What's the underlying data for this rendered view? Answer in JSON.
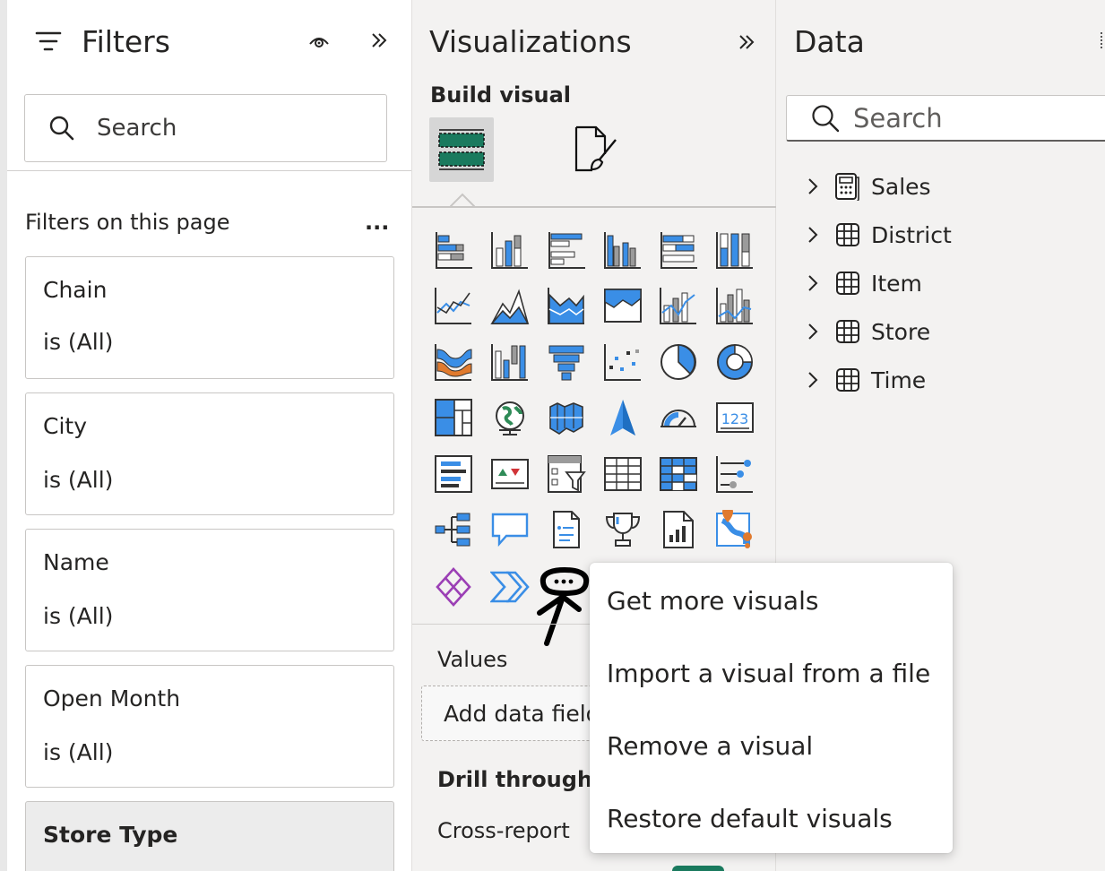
{
  "filters": {
    "title": "Filters",
    "search_placeholder": "Search",
    "section_label": "Filters on this page",
    "more_label": "...",
    "cards": [
      {
        "name": "Chain",
        "value": "is (All)"
      },
      {
        "name": "City",
        "value": "is (All)"
      },
      {
        "name": "Name",
        "value": "is (All)"
      },
      {
        "name": "Open Month",
        "value": "is (All)"
      },
      {
        "name": "Store Type",
        "value": ""
      }
    ]
  },
  "visualizations": {
    "title": "Visualizations",
    "build_label": "Build visual",
    "values_label": "Values",
    "add_field_placeholder": "Add data field",
    "drill_label": "Drill through",
    "cross_report_label": "Cross-report"
  },
  "data": {
    "title": "Data",
    "search_placeholder": "Search",
    "tables": [
      {
        "name": "Sales",
        "icon": "calculator-table-icon"
      },
      {
        "name": "District",
        "icon": "table-icon"
      },
      {
        "name": "Item",
        "icon": "table-icon"
      },
      {
        "name": "Store",
        "icon": "table-icon"
      },
      {
        "name": "Time",
        "icon": "table-icon"
      }
    ]
  },
  "context_menu": {
    "items": [
      "Get more visuals",
      "Import a visual from a file",
      "Remove a visual",
      "Restore default visuals"
    ]
  },
  "colors": {
    "accent_blue": "#118dff",
    "icon_blue": "#3a8ee6",
    "icon_gray": "#9b9b9b",
    "build_green": "#1a7a5e",
    "purple": "#9b3fb5",
    "orange": "#e07a2e"
  }
}
